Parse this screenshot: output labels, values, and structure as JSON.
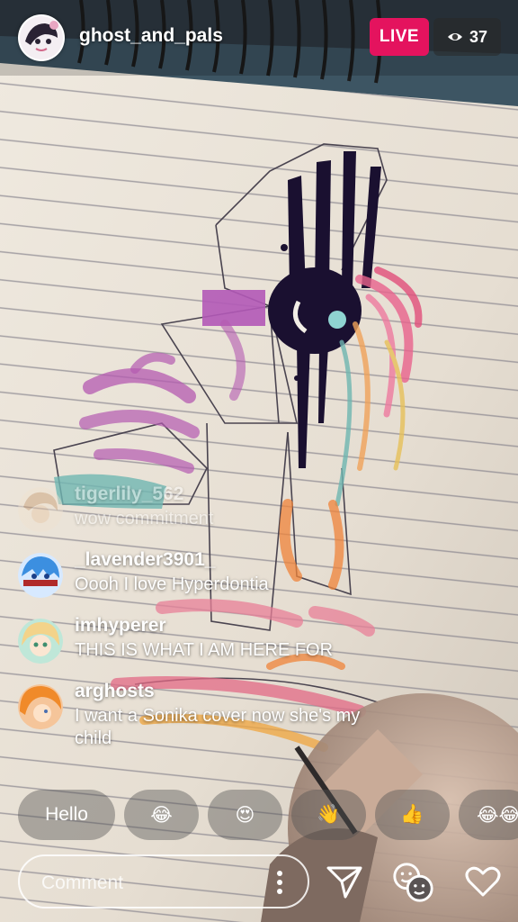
{
  "header": {
    "username": "ghost_and_pals",
    "live_label": "LIVE",
    "viewer_count": "37",
    "viewer_icon": "eye-icon"
  },
  "comments": [
    {
      "user": "tigerlily_562",
      "text": "wow commitment",
      "faded": true,
      "avatar_colors": [
        "#c79a6e",
        "#f0e2d0"
      ]
    },
    {
      "user": "_lavender3901_",
      "text": "Oooh I love Hyperdontia",
      "faded": false,
      "avatar_colors": [
        "#3c8fe0",
        "#d7e9ff"
      ]
    },
    {
      "user": "imhyperer",
      "text": "THIS IS WHAT I AM HERE FOR",
      "faded": false,
      "avatar_colors": [
        "#f3d38a",
        "#bfe7d8"
      ]
    },
    {
      "user": "arghosts",
      "text": "I want a Sonika cover now she's my child",
      "faded": false,
      "avatar_colors": [
        "#f08a2a",
        "#f5c59a"
      ]
    }
  ],
  "quick_replies": [
    {
      "label": "Hello",
      "type": "text"
    },
    {
      "label": "😂",
      "type": "emoji",
      "icon": "tears-of-joy-emoji"
    },
    {
      "label": "😍",
      "type": "emoji",
      "icon": "heart-eyes-emoji"
    },
    {
      "label": "👋",
      "type": "emoji",
      "icon": "waving-hand-emoji"
    },
    {
      "label": "👍",
      "type": "emoji",
      "icon": "thumbs-up-emoji"
    },
    {
      "label": "😂😂",
      "type": "emoji",
      "icon": "tears-of-joy-emoji"
    }
  ],
  "composer": {
    "placeholder": "Comment",
    "more_icon": "more-vertical-icon",
    "send_icon": "send-icon",
    "question_icon": "faces-icon",
    "like_icon": "heart-icon"
  },
  "colors": {
    "live": "#e4135e",
    "paper": "#ece6dc",
    "ink": "#1a1030"
  }
}
